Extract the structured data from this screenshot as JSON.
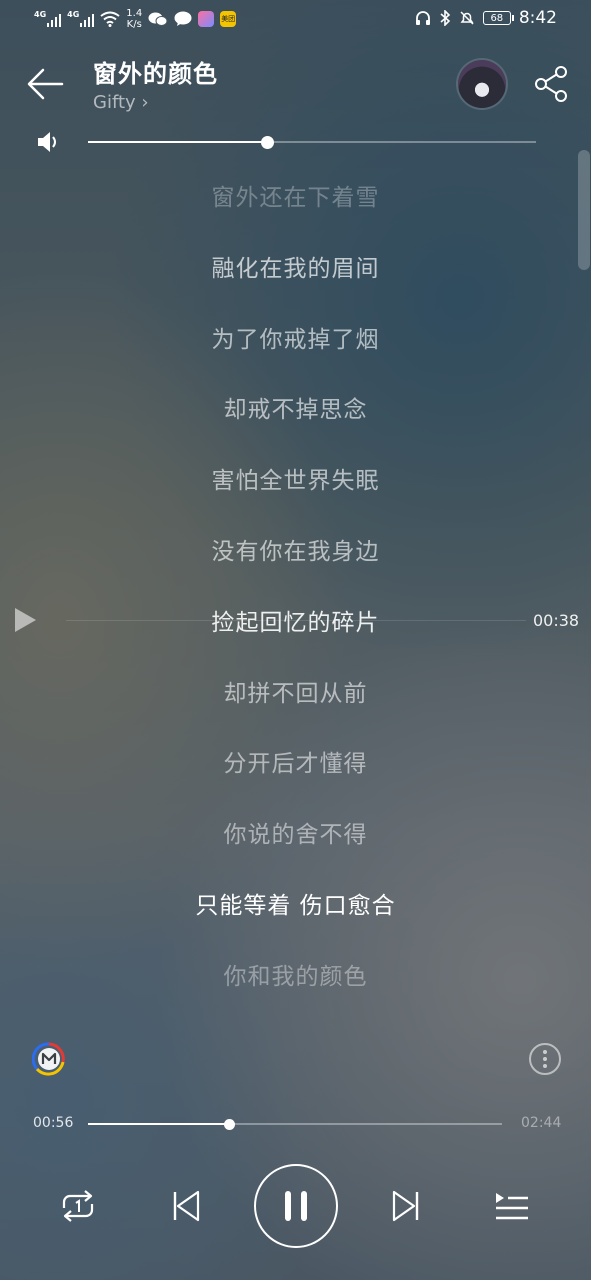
{
  "status_bar": {
    "network_1": "4G",
    "network_2": "4G",
    "speed_value": "1.4",
    "speed_unit": "K/s",
    "meituan_badge": "美团",
    "battery": "68",
    "time": "8:42"
  },
  "header": {
    "title": "窗外的颜色",
    "artist": "Gifty",
    "artist_chevron": "›"
  },
  "volume": {
    "level": 0.4
  },
  "lyrics": {
    "lines": [
      {
        "text": "窗外还在下着雪",
        "opacity": 0.3
      },
      {
        "text": "融化在我的眉间",
        "opacity": 0.7
      },
      {
        "text": "为了你戒掉了烟",
        "opacity": 0.62
      },
      {
        "text": "却戒不掉思念",
        "opacity": 0.62
      },
      {
        "text": "害怕全世界失眠",
        "opacity": 0.62
      },
      {
        "text": "没有你在我身边",
        "opacity": 0.62
      },
      {
        "text": "捡起回忆的碎片",
        "opacity": 0.9
      },
      {
        "text": "却拼不回从前",
        "opacity": 0.58
      },
      {
        "text": "分开后才懂得",
        "opacity": 0.55
      },
      {
        "text": "你说的舍不得",
        "opacity": 0.5
      },
      {
        "text": "只能等着 伤口愈合",
        "opacity": 1.0
      },
      {
        "text": "你和我的颜色",
        "opacity": 0.38
      }
    ],
    "seek_time": "00:38"
  },
  "playback": {
    "elapsed": "00:56",
    "total": "02:44",
    "progress": 0.341
  },
  "colors": {
    "accent": "#ffffff",
    "logo_red": "#e53935",
    "logo_yellow": "#f5c400",
    "logo_blue": "#2b6cf0"
  },
  "icons": {
    "back": "arrow-left-icon",
    "share": "share-icon",
    "volume": "speaker-icon",
    "play_seek": "play-icon",
    "logo": "m-logo-icon",
    "more": "more-icon",
    "repeat": "repeat-one-icon",
    "prev": "skip-previous-icon",
    "pause": "pause-icon",
    "next": "skip-next-icon",
    "playlist": "playlist-icon"
  }
}
